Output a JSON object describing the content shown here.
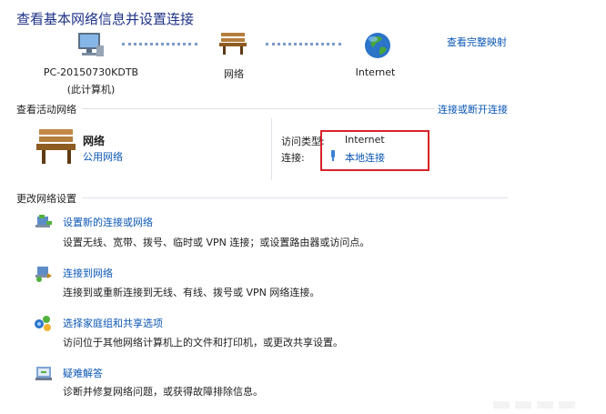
{
  "header": {
    "title": "查看基本网络信息并设置连接",
    "full_map_link": "查看完整映射"
  },
  "network_map": {
    "computer_name": "PC-20150730KDTB",
    "computer_sub": "(此计算机)",
    "network_label": "网络",
    "internet_label": "Internet"
  },
  "active_networks": {
    "section_title": "查看活动网络",
    "connect_link": "连接或断开连接",
    "network_name": "网络",
    "network_type_link": "公用网络",
    "access_type_label": "访问类型:",
    "access_type_value": "Internet",
    "connection_label": "连接:",
    "connection_value": "本地连接"
  },
  "change_settings": {
    "section_title": "更改网络设置",
    "tasks": [
      {
        "icon": "new-connection-icon",
        "title": "设置新的连接或网络",
        "desc": "设置无线、宽带、拨号、临时或 VPN 连接；或设置路由器或访问点。"
      },
      {
        "icon": "connect-network-icon",
        "title": "连接到网络",
        "desc": "连接到或重新连接到无线、有线、拨号或 VPN 网络连接。"
      },
      {
        "icon": "homegroup-icon",
        "title": "选择家庭组和共享选项",
        "desc": "访问位于其他网络计算机上的文件和打印机，或更改共享设置。"
      },
      {
        "icon": "troubleshoot-icon",
        "title": "疑难解答",
        "desc": "诊断并修复网络问题，或获得故障排除信息。"
      }
    ]
  },
  "colors": {
    "title": "#1e3287",
    "link": "#0b57b5",
    "highlight": "#d8232a"
  }
}
